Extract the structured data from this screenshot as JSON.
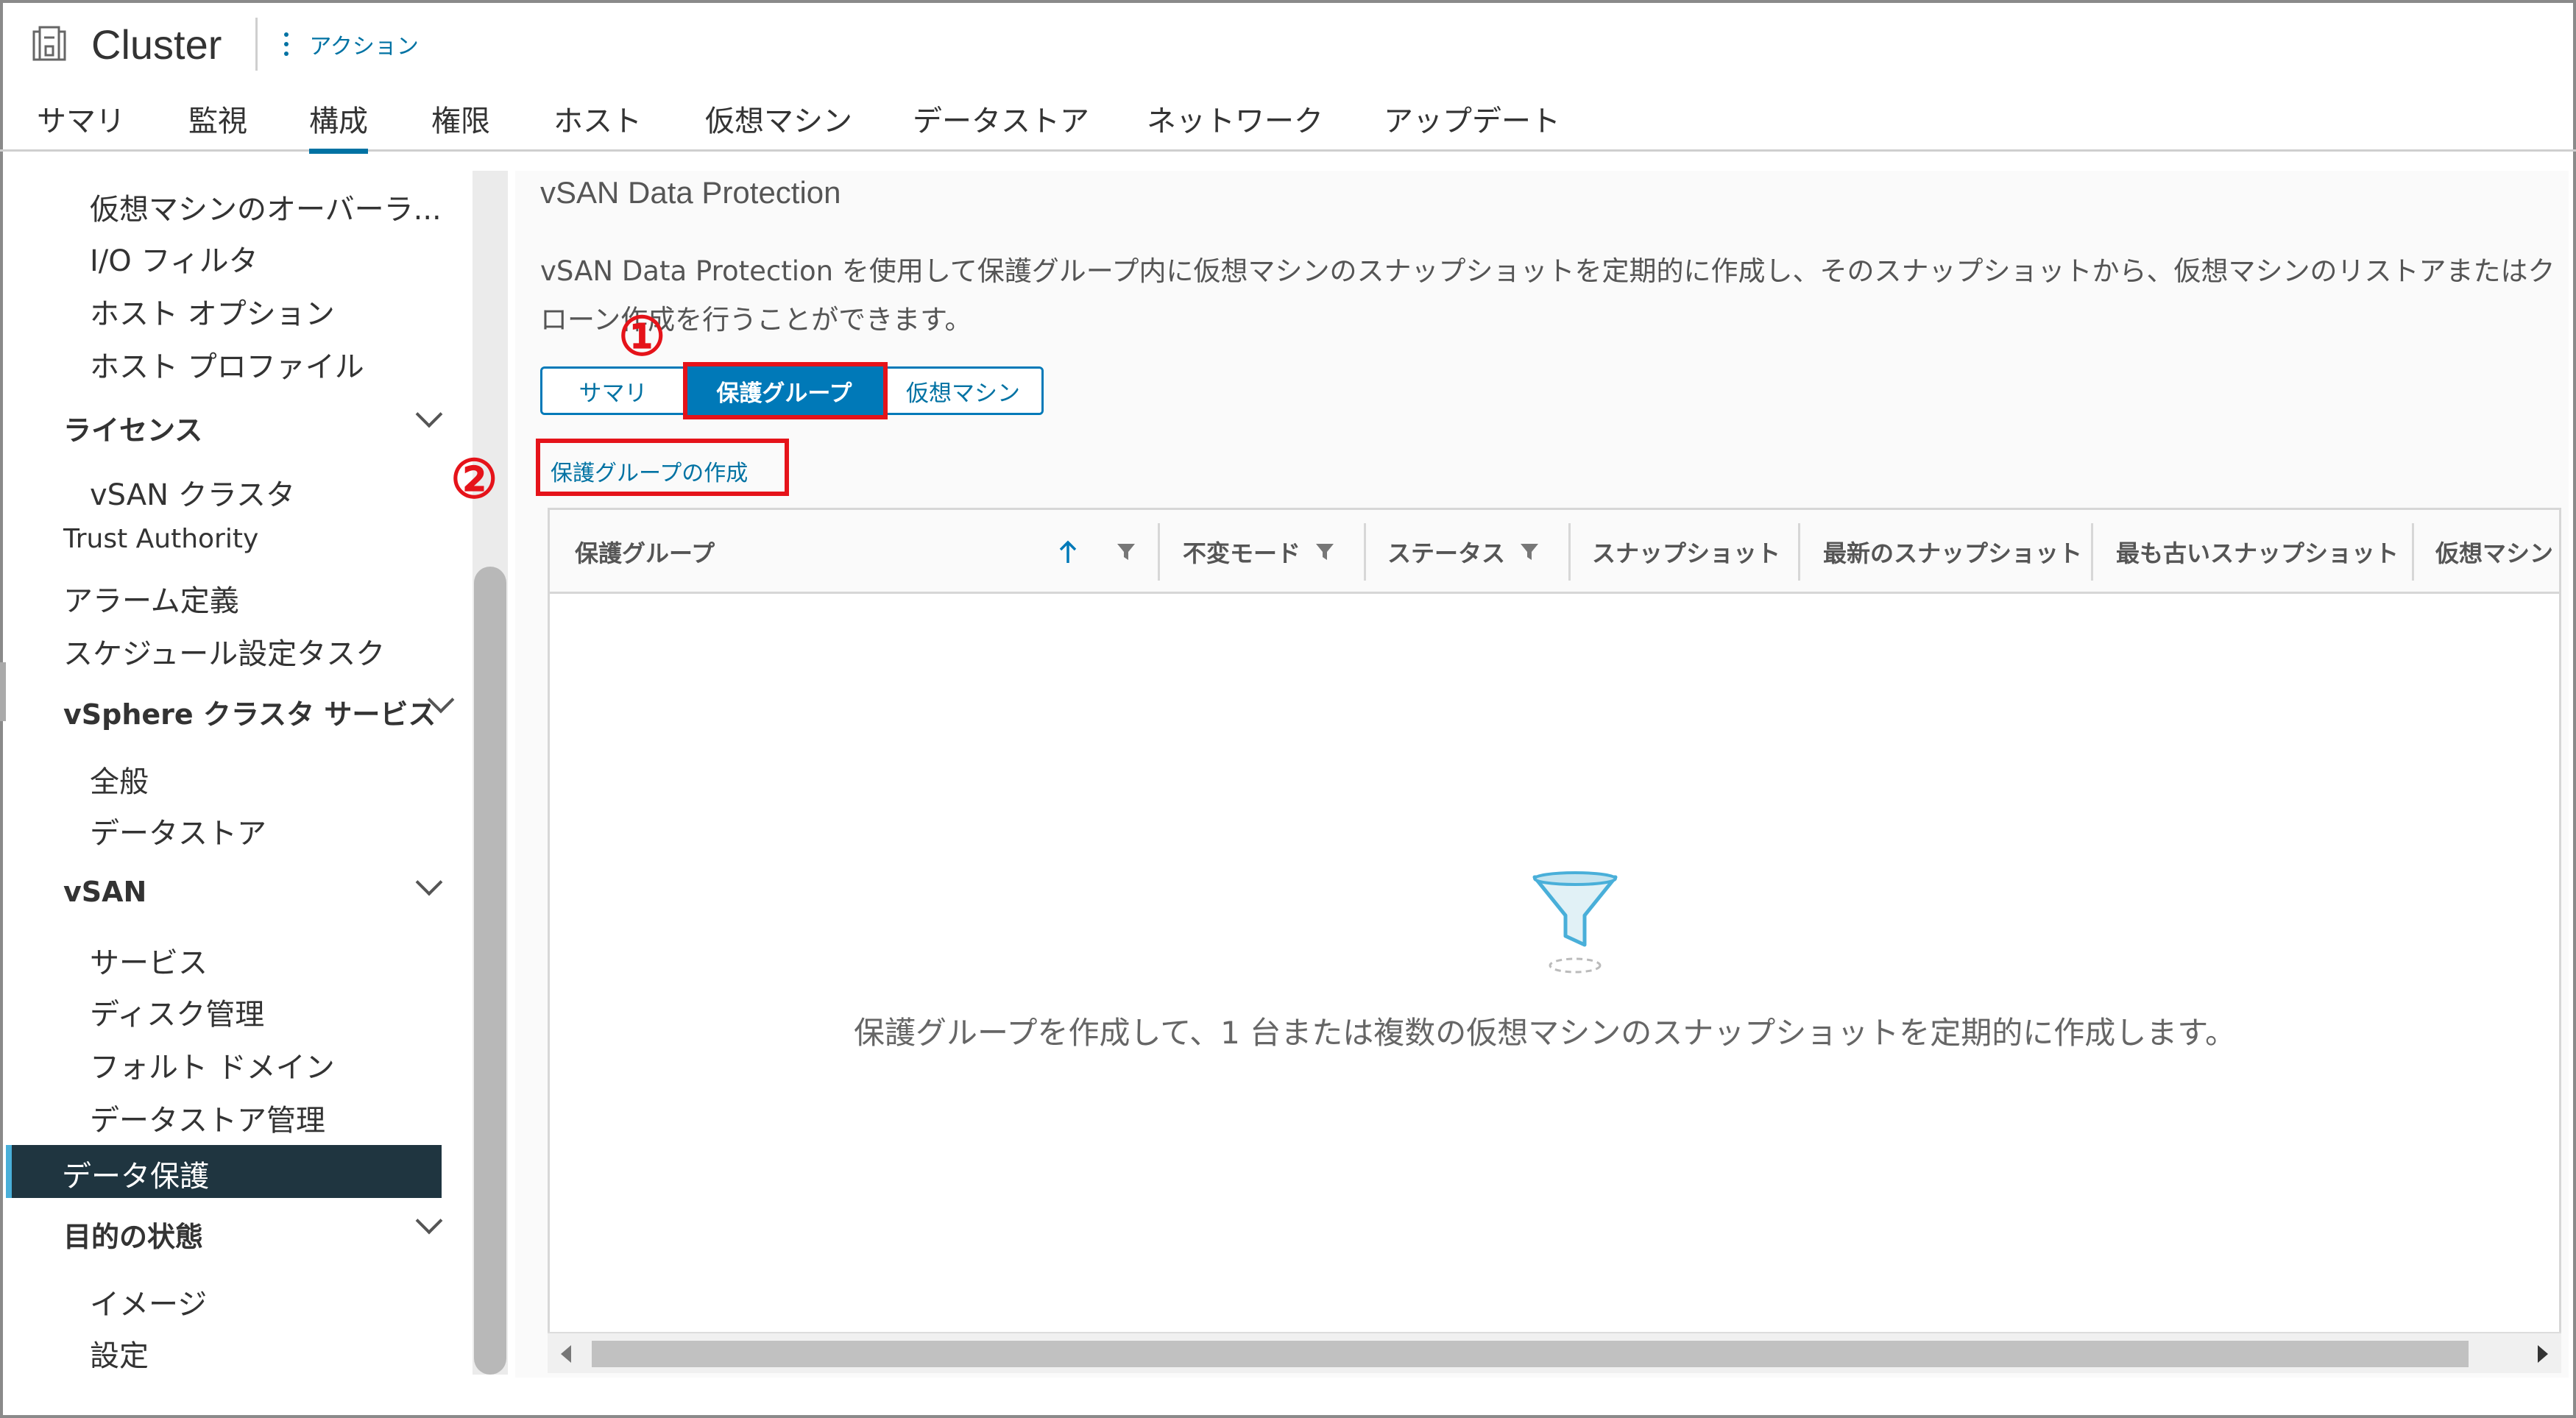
{
  "header": {
    "title": "Cluster",
    "actions_label": "アクション",
    "icon": "cluster-icon"
  },
  "nav": {
    "tabs": [
      {
        "label": "サマリ"
      },
      {
        "label": "監視"
      },
      {
        "label": "構成",
        "active": true
      },
      {
        "label": "権限"
      },
      {
        "label": "ホスト"
      },
      {
        "label": "仮想マシン"
      },
      {
        "label": "データストア"
      },
      {
        "label": "ネットワーク"
      },
      {
        "label": "アップデート"
      }
    ]
  },
  "sidebar": {
    "items": [
      "仮想マシンのオーバーラ...",
      "I/O フィルタ",
      "ホスト オプション",
      "ホスト プロファイル",
      "ライセンス",
      "vSAN クラスタ",
      "Trust Authority",
      "アラーム定義",
      "スケジュール設定タスク",
      "vSphere クラスタ サービス",
      "全般",
      "データストア",
      "vSAN",
      "サービス",
      "ディスク管理",
      "フォルト ドメイン",
      "データストア管理",
      "データ保護",
      "目的の状態",
      "イメージ",
      "設定"
    ],
    "active_item": "データ保護"
  },
  "main": {
    "title": "vSAN Data Protection",
    "description": "vSAN Data Protection を使用して保護グループ内に仮想マシンのスナップショットを定期的に作成し、そのスナップショットから、仮想マシンのリストアまたはクローン作成を行うことができます。",
    "segments": [
      {
        "label": "サマリ"
      },
      {
        "label": "保護グループ",
        "active": true
      },
      {
        "label": "仮想マシン"
      }
    ],
    "create_link": "保護グループの作成",
    "grid": {
      "columns": [
        "保護グループ",
        "不変モード",
        "ステータス",
        "スナップショット",
        "最新のスナップショット",
        "最も古いスナップショット",
        "仮想マシン"
      ],
      "empty_message": "保護グループを作成して、1 台または複数の仮想マシンのスナップショットを定期的に作成します。"
    }
  },
  "annotations": {
    "marker1": "①",
    "marker2": "②",
    "color": "#e5131a"
  },
  "colors": {
    "accent": "#0079b8",
    "link": "#0072a3",
    "active_sidebar_bg": "#1f3540"
  }
}
